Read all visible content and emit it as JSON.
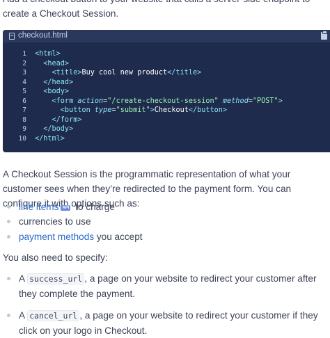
{
  "intro": "Add a checkout button to your website that calls a server-side endpoint to create a Checkout Session.",
  "code_block": {
    "filename": "checkout.html",
    "icons": {
      "file": "file-icon",
      "copy": "copy-icon"
    },
    "line_numbers": [
      "1",
      "2",
      "3",
      "4",
      "5",
      "6",
      "7",
      "8",
      "9",
      "10"
    ],
    "lines": [
      [
        {
          "t": "tag",
          "v": "<html>"
        }
      ],
      [
        {
          "t": "tag",
          "v": "  <head>"
        }
      ],
      [
        {
          "t": "tag",
          "v": "    <title>"
        },
        {
          "t": "txt",
          "v": "Buy cool new product"
        },
        {
          "t": "tag",
          "v": "</title>"
        }
      ],
      [
        {
          "t": "tag",
          "v": "  </head>"
        }
      ],
      [
        {
          "t": "tag",
          "v": "  <body>"
        }
      ],
      [
        {
          "t": "tag",
          "v": "    <form "
        },
        {
          "t": "attr",
          "v": "action"
        },
        {
          "t": "txt",
          "v": "="
        },
        {
          "t": "str",
          "v": "\"/create-checkout-session\""
        },
        {
          "t": "txt",
          "v": " "
        },
        {
          "t": "attr",
          "v": "method"
        },
        {
          "t": "txt",
          "v": "="
        },
        {
          "t": "str",
          "v": "\"POST\""
        },
        {
          "t": "tag",
          "v": ">"
        }
      ],
      [
        {
          "t": "tag",
          "v": "      <button "
        },
        {
          "t": "attr",
          "v": "type"
        },
        {
          "t": "txt",
          "v": "="
        },
        {
          "t": "str",
          "v": "\"submit\""
        },
        {
          "t": "tag",
          "v": ">"
        },
        {
          "t": "txt",
          "v": "Checkout"
        },
        {
          "t": "tag",
          "v": "</button>"
        }
      ],
      [
        {
          "t": "tag",
          "v": "    </form>"
        }
      ],
      [
        {
          "t": "tag",
          "v": "  </body>"
        }
      ],
      [
        {
          "t": "tag",
          "v": "</html>"
        }
      ]
    ],
    "colors": {
      "background": "#1e2b4d",
      "header": "#2a385e",
      "tag": "#8ee3f5",
      "string": "#9ff2b3"
    }
  },
  "description": "A Checkout Session is the programmatic representation of what your customer sees when they’re redirected to the payment form. You can configure it with options such as:",
  "options": [
    {
      "link": "line items",
      "badge": "API",
      "suffix": " to charge"
    },
    {
      "text": "currencies to use"
    },
    {
      "link": "payment methods",
      "suffix": " you accept"
    }
  ],
  "need_text": "You also need to specify:",
  "specify": [
    {
      "prefix": "A ",
      "code": "success_url",
      "suffix": ", a page on your website to redirect your customer after they complete the payment."
    },
    {
      "prefix": "A ",
      "code": "cancel_url",
      "suffix": ", a page on your website to redirect your customer if they click on your logo in Checkout."
    }
  ],
  "colors": {
    "link": "#2b69c9",
    "text": "#3c4257"
  }
}
